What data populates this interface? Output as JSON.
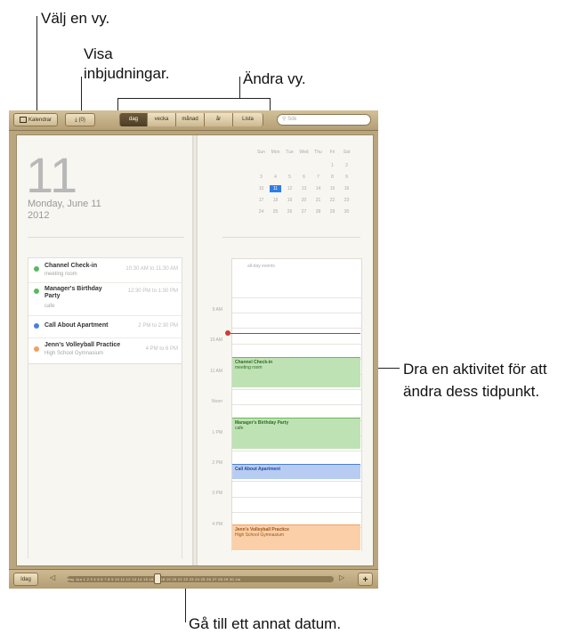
{
  "callouts": {
    "select_view": "Välj en vy.",
    "show_invites": "Visa\ninbjudningar.",
    "change_view": "Ändra vy.",
    "drag_event": "Dra en aktivitet för att\nändra dess tidpunkt.",
    "go_to_date": "Gå till ett annat datum."
  },
  "toolbar": {
    "calendars_label": "Kalendrar",
    "invites_label": "(0)",
    "tabs": [
      "dag",
      "vecka",
      "månad",
      "år",
      "Lista"
    ],
    "active_tab": "dag",
    "search_placeholder": "Sök"
  },
  "day_page": {
    "day_number": "11",
    "weekday_date": "Monday, June 11",
    "year": "2012",
    "events": [
      {
        "title": "Channel Check-in",
        "location": "meeting room",
        "time": "10:30 AM to 11:30 AM",
        "color": "#5cb85c"
      },
      {
        "title": "Manager's Birthday\nParty",
        "location": "cafe",
        "time": "12:30 PM to 1:30 PM",
        "color": "#5cb85c"
      },
      {
        "title": "Call About Apartment",
        "location": "",
        "time": "2 PM to 2:30 PM",
        "color": "#4a80d8"
      },
      {
        "title": "Jenn's Volleyball Practice",
        "location": "High School Gymnasium",
        "time": "4 PM to 6 PM",
        "color": "#f0a060"
      }
    ]
  },
  "mini_calendar": {
    "weekdays": [
      "Sun",
      "Mon",
      "Tue",
      "Wed",
      "Thu",
      "Fri",
      "Sat"
    ],
    "weeks": [
      [
        "",
        "",
        "",
        "",
        "",
        "1",
        "2"
      ],
      [
        "3",
        "4",
        "5",
        "6",
        "7",
        "8",
        "9"
      ],
      [
        "10",
        "11",
        "12",
        "13",
        "14",
        "15",
        "16"
      ],
      [
        "17",
        "18",
        "19",
        "20",
        "21",
        "22",
        "23"
      ],
      [
        "24",
        "25",
        "26",
        "27",
        "28",
        "29",
        "30"
      ]
    ],
    "selected": "11"
  },
  "timeline": {
    "all_day_label": "all-day events",
    "hours": [
      "9 AM",
      "10 AM",
      "11 AM",
      "Noon",
      "1 PM",
      "2 PM",
      "3 PM",
      "4 PM"
    ],
    "events": [
      {
        "title": "Channel Check-in",
        "location": "meeting room",
        "bg": "#bfe2b5",
        "border": "#6cb55e",
        "text": "#2e6a22"
      },
      {
        "title": "Manager's Birthday Party",
        "location": "cafe",
        "bg": "#bfe2b5",
        "border": "#6cb55e",
        "text": "#2e6a22"
      },
      {
        "title": "Call About Apartment",
        "location": "",
        "bg": "#b8ccf2",
        "border": "#4a80d8",
        "text": "#1f4a9c"
      },
      {
        "title": "Jenn's Volleyball Practice",
        "location": "High School Gymnasium",
        "bg": "#fbd0a8",
        "border": "#f0a060",
        "text": "#9c5418"
      }
    ]
  },
  "bottom_bar": {
    "today_label": "Idag",
    "day_strip": "May  Jun 1 2 3 4 5 6 7 8 9 10 11 12 13 14 15 16 17 18 19 20 21 22 23 24 25 26 27 28 29 30  Jul",
    "add_label": "+"
  }
}
